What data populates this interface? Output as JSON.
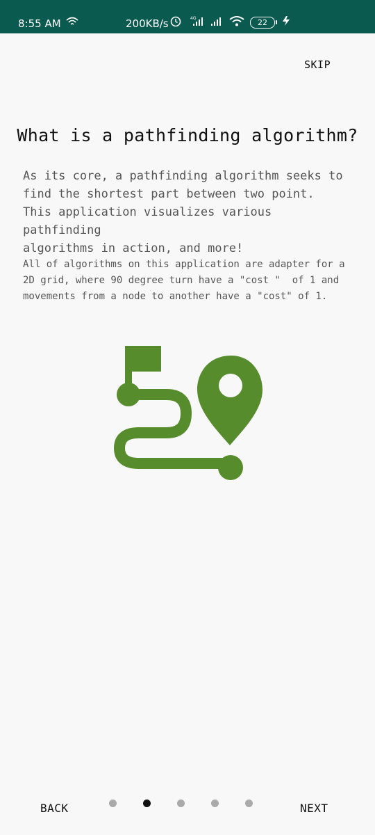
{
  "status_bar": {
    "time": "8:55 AM",
    "speed": "200KB/s",
    "battery": "22",
    "icons": [
      "wifi-icon",
      "alarm-icon",
      "signal-4g-icon",
      "signal-icon",
      "wifi-icon",
      "battery-icon",
      "charging-icon"
    ]
  },
  "top": {
    "skip_label": "SKIP"
  },
  "content": {
    "title": "What is a pathfinding algorithm?",
    "para1_lines": [
      "As its core, a pathfinding algorithm seeks to",
      "find the shortest part between two point.",
      "This application visualizes various pathfinding",
      "algorithms in action, and more!"
    ],
    "para2_lines": [
      "All of algorithms on this application are adapter for a",
      "2D grid, where 90 degree turn have a \"cost \"  of 1 and",
      "movements from a node to another have a \"cost\" of 1."
    ],
    "illustration_icon": "route-path-icon",
    "accent_color": "#578c2c"
  },
  "bottom": {
    "back_label": "BACK",
    "next_label": "NEXT",
    "page_count": 5,
    "current_page": 2
  }
}
